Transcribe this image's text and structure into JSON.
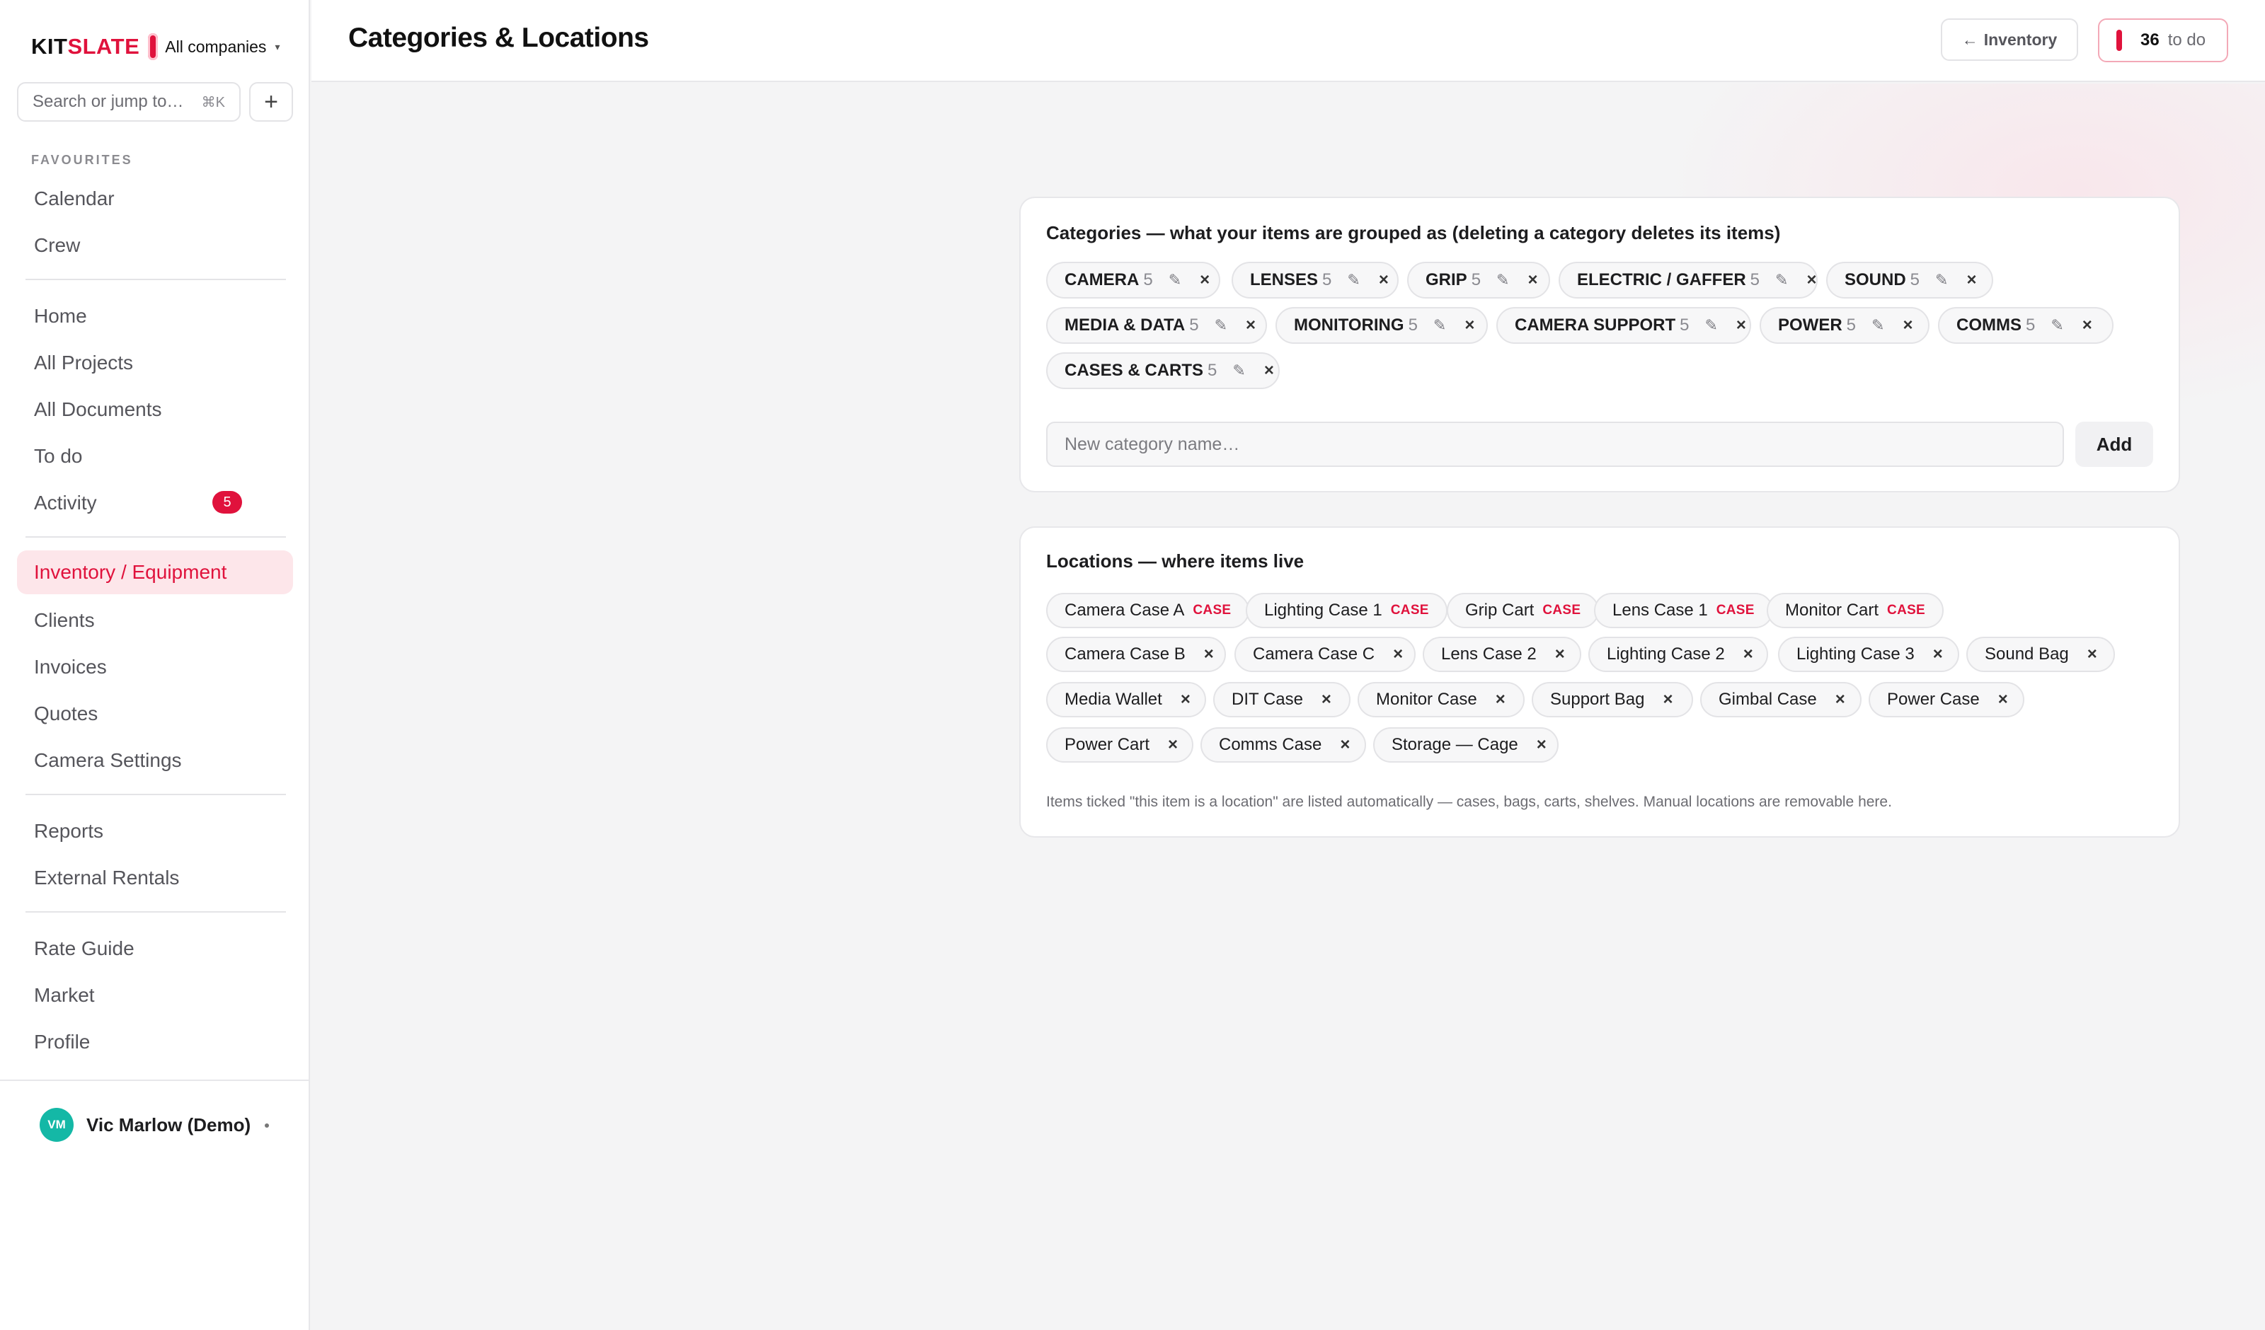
{
  "brand": {
    "name_prefix": "KIT",
    "name_suffix": "SLATE",
    "company": "All companies",
    "company_caret": "▾"
  },
  "search": {
    "placeholder": "Search or jump to…",
    "shortcut": "⌘K",
    "add_label": "+"
  },
  "sidebar": {
    "favourites_label": "FAVOURITES",
    "favourites": [
      "Calendar",
      "Crew"
    ],
    "group1": [
      "Home",
      "All Projects",
      "All Documents",
      "To do",
      "Activity"
    ],
    "activity_badge": "5",
    "group2": [
      "Inventory / Equipment",
      "Clients",
      "Invoices",
      "Quotes",
      "Camera Settings"
    ],
    "group3": [
      "Reports",
      "External Rentals"
    ],
    "group4": [
      "Rate Guide",
      "Market",
      "Profile"
    ],
    "active_item": "Inventory / Equipment"
  },
  "user": {
    "initials": "VM",
    "name": "Vic Marlow (Demo)"
  },
  "header": {
    "title": "Categories & Locations",
    "back_arrow": "←",
    "back_label": "Inventory",
    "todo_count": "36",
    "todo_label": "to do"
  },
  "categories": {
    "title": "Categories — what your items are grouped as (deleting a category deletes its items)",
    "items": [
      {
        "name": "CAMERA",
        "count": "5"
      },
      {
        "name": "LENSES",
        "count": "5"
      },
      {
        "name": "GRIP",
        "count": "5"
      },
      {
        "name": "ELECTRIC / GAFFER",
        "count": "5"
      },
      {
        "name": "SOUND",
        "count": "5"
      },
      {
        "name": "MEDIA & DATA",
        "count": "5"
      },
      {
        "name": "MONITORING",
        "count": "5"
      },
      {
        "name": "CAMERA SUPPORT",
        "count": "5"
      },
      {
        "name": "POWER",
        "count": "5"
      },
      {
        "name": "COMMS",
        "count": "5"
      },
      {
        "name": "CASES & CARTS",
        "count": "5"
      }
    ],
    "edit_icon": "✎",
    "delete_icon": "×",
    "new_placeholder": "New category name…",
    "add_label": "Add"
  },
  "locations": {
    "title": "Locations — where items live",
    "case_tag": "CASE",
    "items": [
      {
        "name": "Camera Case A",
        "is_case": true
      },
      {
        "name": "Lighting Case 1",
        "is_case": true
      },
      {
        "name": "Grip Cart",
        "is_case": true
      },
      {
        "name": "Lens Case 1",
        "is_case": true
      },
      {
        "name": "Monitor Cart",
        "is_case": true
      },
      {
        "name": "Camera Case B",
        "is_case": false
      },
      {
        "name": "Camera Case C",
        "is_case": false
      },
      {
        "name": "Lens Case 2",
        "is_case": false
      },
      {
        "name": "Lighting Case 2",
        "is_case": false
      },
      {
        "name": "Lighting Case 3",
        "is_case": false
      },
      {
        "name": "Sound Bag",
        "is_case": false
      },
      {
        "name": "Media Wallet",
        "is_case": false
      },
      {
        "name": "DIT Case",
        "is_case": false
      },
      {
        "name": "Monitor Case",
        "is_case": false
      },
      {
        "name": "Support Bag",
        "is_case": false
      },
      {
        "name": "Gimbal Case",
        "is_case": false
      },
      {
        "name": "Power Case",
        "is_case": false
      },
      {
        "name": "Power Cart",
        "is_case": false
      },
      {
        "name": "Comms Case",
        "is_case": false
      },
      {
        "name": "Storage — Cage",
        "is_case": false
      }
    ],
    "note": "Items ticked \"this item is a location\" are listed automatically — cases, bags, carts, shelves. Manual locations are removable here."
  },
  "colors": {
    "accent": "#e0123c",
    "avatar": "#14b8a6"
  }
}
